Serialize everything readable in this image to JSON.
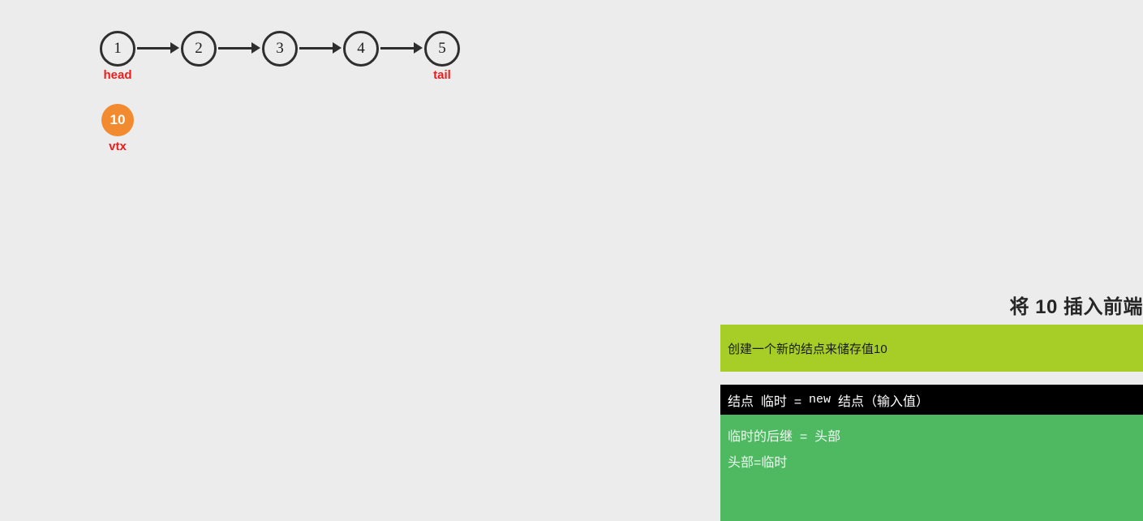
{
  "diagram": {
    "list_nodes": [
      {
        "value": "1",
        "pointer": "head"
      },
      {
        "value": "2",
        "pointer": ""
      },
      {
        "value": "3",
        "pointer": ""
      },
      {
        "value": "4",
        "pointer": ""
      },
      {
        "value": "5",
        "pointer": "tail"
      }
    ],
    "new_node": {
      "value": "10",
      "pointer": "vtx",
      "color": "#f28b30"
    },
    "pointer_color": "#ee1c1c",
    "node_outline_color": "#2e2e2e"
  },
  "panel": {
    "title": "将 10 插入前端",
    "note": "创建一个新的结点来储存值10",
    "note_bg": "#a6ce27",
    "code_bg": "#4fb962",
    "code_lines": [
      {
        "prefix": "结点  临时  =  ",
        "keyword": "new",
        "suffix": "  结点（输入值）",
        "highlighted": true
      },
      {
        "prefix": "临时的后继  =  头部",
        "keyword": "",
        "suffix": "",
        "highlighted": false
      },
      {
        "prefix": "头部=临时",
        "keyword": "",
        "suffix": "",
        "highlighted": false
      }
    ]
  }
}
